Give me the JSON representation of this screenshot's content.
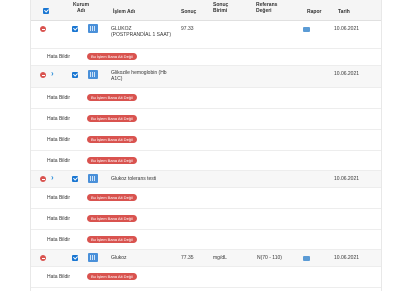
{
  "header": {
    "kurum_adi": "Kurum Adı",
    "islem_adi": "İşlem Adı",
    "sonuc": "Sonuç",
    "sonuc_birimi": "Sonuç Birimi",
    "referans_degeri": "Referans Değeri",
    "rapor": "Rapor",
    "tarih": "Tarih"
  },
  "labels": {
    "hata_bildir": "Hata Bildir",
    "pill": "Bu İşlem Bana Ait Değil"
  },
  "rows": [
    {
      "name": "GLUKOZ (POSTPRANDİAL 1 SAAT)",
      "sonuc": "97.33",
      "birim": "",
      "referans": "",
      "tarih": "10.06.2021"
    },
    {
      "name": "Glikozile hemoglobin (Hb A1C)",
      "sonuc": "",
      "birim": "",
      "referans": "",
      "tarih": "10.06.2021"
    },
    {
      "name": "Glukoz tolerans testi",
      "sonuc": "",
      "birim": "",
      "referans": "",
      "tarih": "10.06.2021"
    },
    {
      "name": "Glukoz",
      "sonuc": "77.35",
      "birim": "mg/dL",
      "referans": "N(70 - 110)",
      "tarih": "10.06.2021"
    }
  ],
  "icons": {
    "collapse": "minus-circle-icon",
    "expand": "chevron-right-icon",
    "institution": "building-icon",
    "report": "report-icon",
    "checkbox": "checkbox-icon"
  },
  "colors": {
    "accent": "#1976d2",
    "danger": "#d9534f",
    "header_bg": "#f5f5f5"
  }
}
